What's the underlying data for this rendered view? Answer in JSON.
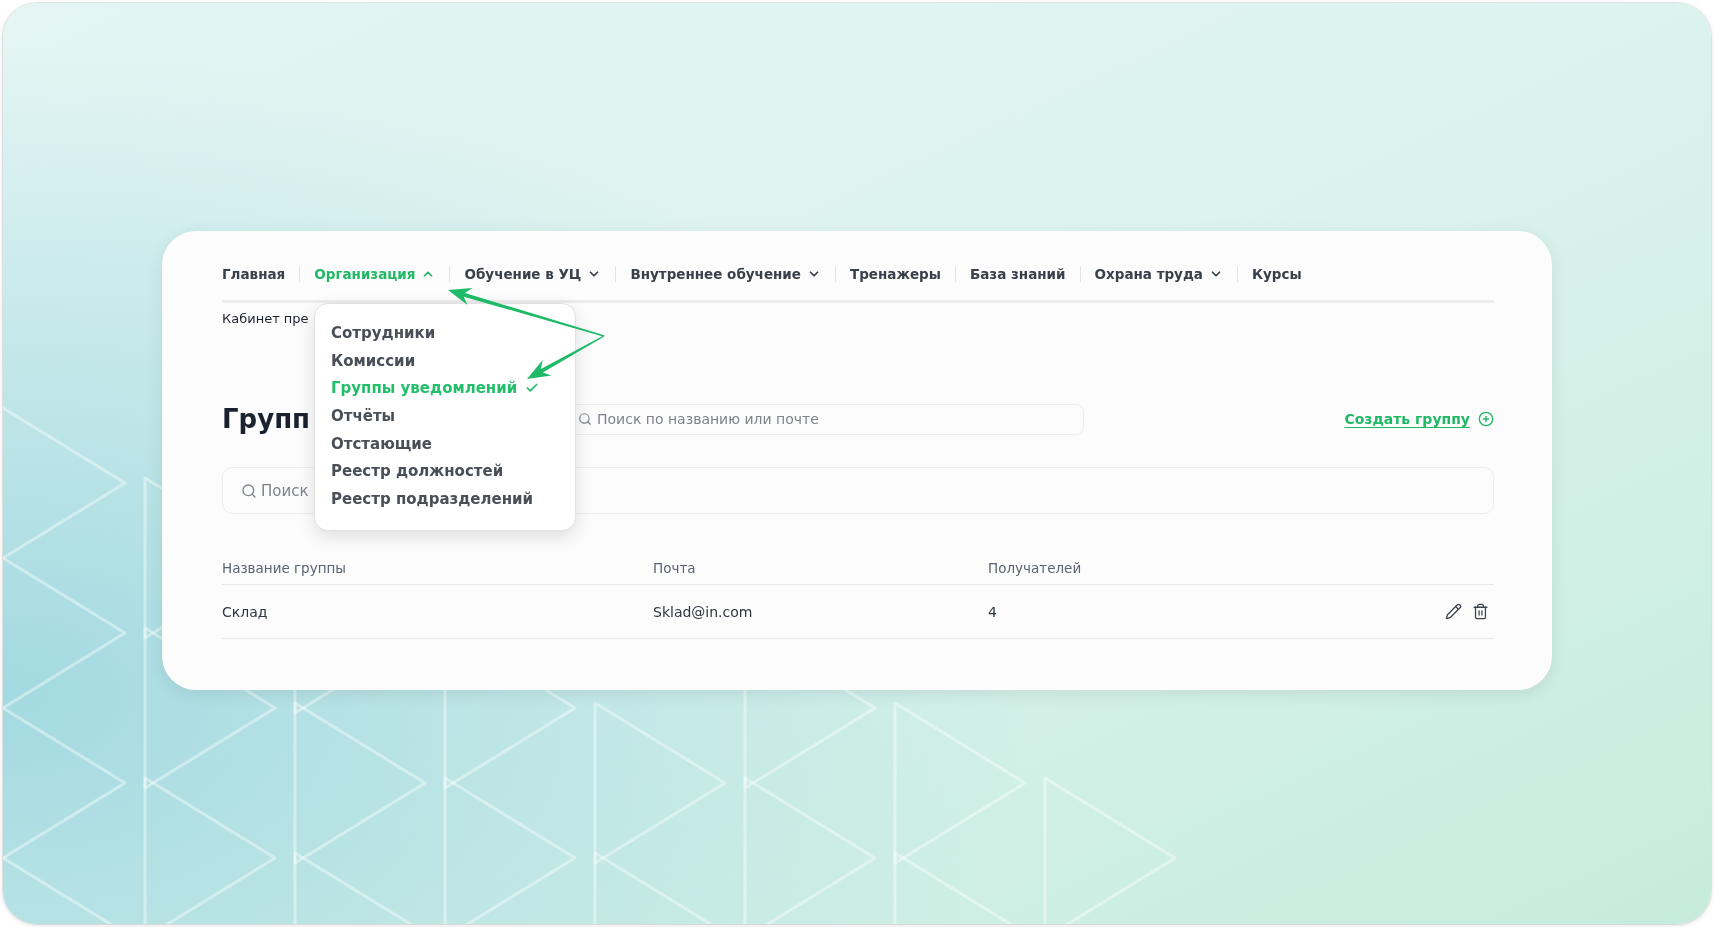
{
  "nav": {
    "items": [
      {
        "label": "Главная",
        "kind": "link",
        "selected": false
      },
      {
        "label": "Организация",
        "kind": "menu",
        "selected": true,
        "expanded": true
      },
      {
        "label": "Обучение в УЦ",
        "kind": "menu",
        "selected": false,
        "expanded": false
      },
      {
        "label": "Внутреннее обучение",
        "kind": "menu",
        "selected": false,
        "expanded": false
      },
      {
        "label": "Тренажеры",
        "kind": "link",
        "selected": false
      },
      {
        "label": "База знаний",
        "kind": "link",
        "selected": false
      },
      {
        "label": "Охрана труда",
        "kind": "menu",
        "selected": false,
        "expanded": false
      },
      {
        "label": "Курсы",
        "kind": "link",
        "selected": false
      }
    ]
  },
  "breadcrumb": "Кабинет пре",
  "dropdown_menu": {
    "items": [
      {
        "label": "Сотрудники",
        "selected": false
      },
      {
        "label": "Комиссии",
        "selected": false
      },
      {
        "label": "Группы уведомлений",
        "selected": true
      },
      {
        "label": "Отчёты",
        "selected": false
      },
      {
        "label": "Отстающие",
        "selected": false
      },
      {
        "label": "Реестр должностей",
        "selected": false
      },
      {
        "label": "Реестр подразделений",
        "selected": false
      }
    ]
  },
  "page_title": "Групп",
  "top_search": {
    "placeholder": "Поиск по названию или почте"
  },
  "create_group_link": {
    "label": "Создать группу"
  },
  "search": {
    "placeholder": "Поиск"
  },
  "table": {
    "columns": [
      "Название группы",
      "Почта",
      "Получателей"
    ],
    "rows": [
      {
        "cells": [
          "Склад",
          "Sklad@in.com",
          "4"
        ]
      }
    ]
  }
}
